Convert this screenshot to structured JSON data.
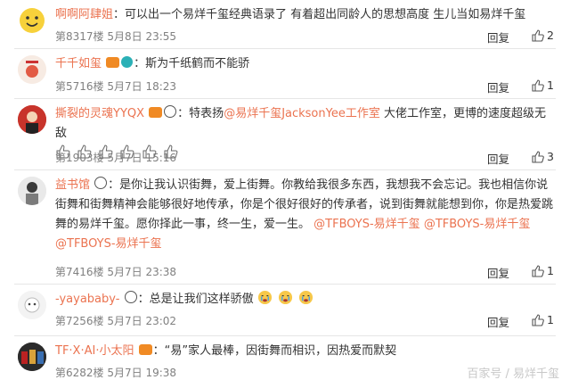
{
  "reply_label": "回复",
  "comments": [
    {
      "name": "啊啊阿肆姐",
      "text": "：可以出一个易烊千玺经典语录了 有着超出同龄人的思想高度 生儿当如易烊千玺",
      "meta": "第8317楼 5月8日 23:55",
      "likes": "2"
    },
    {
      "name": "千千如玺",
      "text": "：斯为千纸鹤而不能骄",
      "meta": "第5716楼 5月7日 18:23",
      "likes": "1"
    },
    {
      "name": "撕裂的灵魂YYQX",
      "text_pre": "：特表扬",
      "mention": "@易烊千玺JacksonYee工作室",
      "text_post": " 大佬工作室，更博的速度超级无敌",
      "meta": "第1903楼 5月7日 15:16",
      "likes": "3"
    },
    {
      "name": "益书馆",
      "text": "：是你让我认识街舞，爱上街舞。你教给我很多东西，我想我不会忘记。我也相信你说街舞和街舞精神会能够很好地传承，你是个很好很好的传承者，说到街舞就能想到你，你是热爱跳舞的易烊千玺。愿你择此一事，终一生，爱一生。",
      "mention1": "@TFBOYS-易烊千玺",
      "mention2": "@TFBOYS-易烊千玺",
      "mention3": "@TFBOYS-易烊千玺",
      "meta": "第7416楼 5月7日 23:38",
      "likes": "1"
    },
    {
      "name": "-yayababy-",
      "text": "：总是让我们这样骄傲",
      "meta": "第7256楼 5月7日 23:02",
      "likes": "1"
    },
    {
      "name": "TF·X·AI·小太阳",
      "text": "：“易”家人最棒，因街舞而相识，因热爱而默契",
      "meta": "第6282楼 5月7日 19:38",
      "likes": ""
    }
  ],
  "watermark": "百家号 / 易烊千玺",
  "colors": {
    "name": "#eb7350",
    "meta": "#808080",
    "separator": "#e6e6e6"
  }
}
